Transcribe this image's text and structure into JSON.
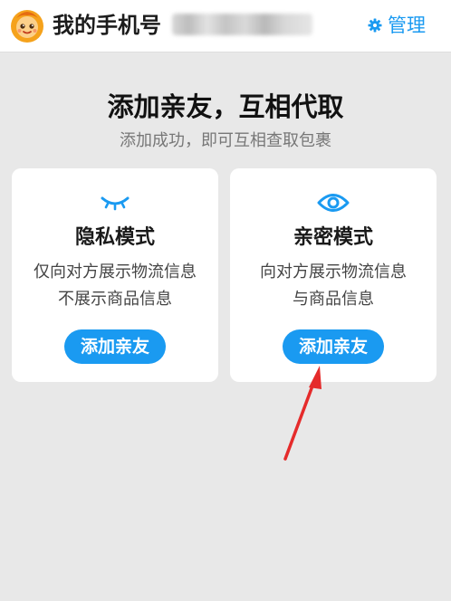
{
  "header": {
    "title": "我的手机号",
    "manage_label": "管理",
    "icons": {
      "avatar": "orange-mascot-avatar",
      "manage": "gear-icon"
    }
  },
  "main": {
    "headline": "添加亲友，互相代取",
    "subhead": "添加成功，即可互相查取包裹"
  },
  "cards": [
    {
      "icon": "closed-eye-icon",
      "title": "隐私模式",
      "desc_line1": "仅向对方展示物流信息",
      "desc_line2": "不展示商品信息",
      "button": "添加亲友"
    },
    {
      "icon": "eye-icon",
      "title": "亲密模式",
      "desc_line1": "向对方展示物流信息",
      "desc_line2": "与商品信息",
      "button": "添加亲友"
    }
  ],
  "colors": {
    "accent": "#1a9af1",
    "background": "#e8e8e8",
    "annotation_arrow": "#e52b2b"
  }
}
